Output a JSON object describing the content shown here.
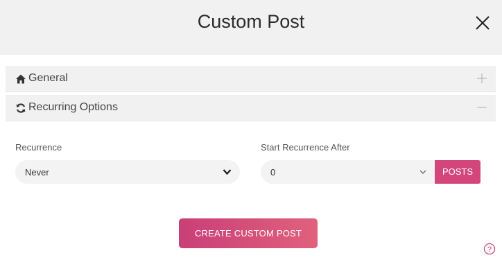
{
  "dialog": {
    "title": "Custom Post",
    "close_icon": "close-icon"
  },
  "sections": {
    "general": {
      "label": "General",
      "icon": "home-icon",
      "toggle_icon": "plus-icon"
    },
    "recurring": {
      "label": "Recurring Options",
      "icon": "refresh-icon",
      "toggle_icon": "minus-icon"
    }
  },
  "form": {
    "recurrence": {
      "label": "Recurrence",
      "value": "Never"
    },
    "start_after": {
      "label": "Start Recurrence After",
      "value": "0",
      "unit_button": "POSTS"
    }
  },
  "actions": {
    "create_label": "CREATE CUSTOM POST"
  },
  "colors": {
    "accent": "#d3467b",
    "gradient_start": "#c93f78",
    "gradient_end": "#e1607c",
    "header_bg": "#f1f1f1",
    "field_bg": "#f3f3f3"
  }
}
